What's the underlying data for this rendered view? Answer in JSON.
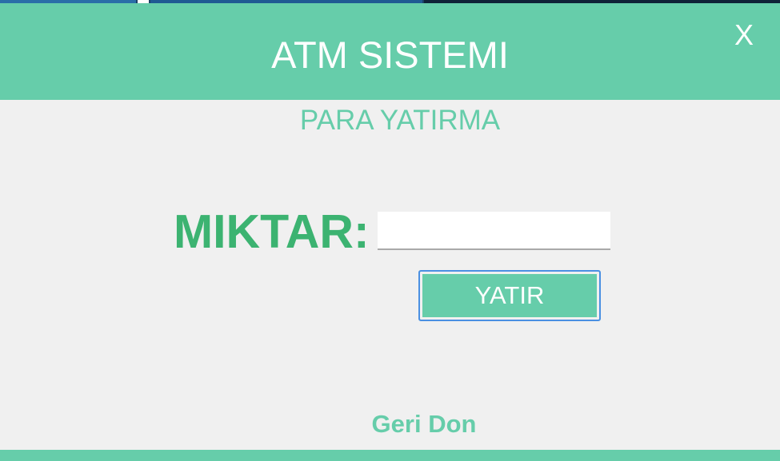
{
  "window": {
    "title": "ATM SISTEMI",
    "close_label": "X"
  },
  "page": {
    "subtitle": "PARA YATIRMA"
  },
  "form": {
    "amount_label": "MIKTAR:",
    "amount_value": "",
    "deposit_button_label": "YATIR"
  },
  "footer": {
    "back_label": "Geri Don"
  },
  "colors": {
    "accent": "#66cdaa",
    "label_green": "#3cb371",
    "background": "#f0f0f0",
    "button_focus_border": "#4a90e2"
  }
}
